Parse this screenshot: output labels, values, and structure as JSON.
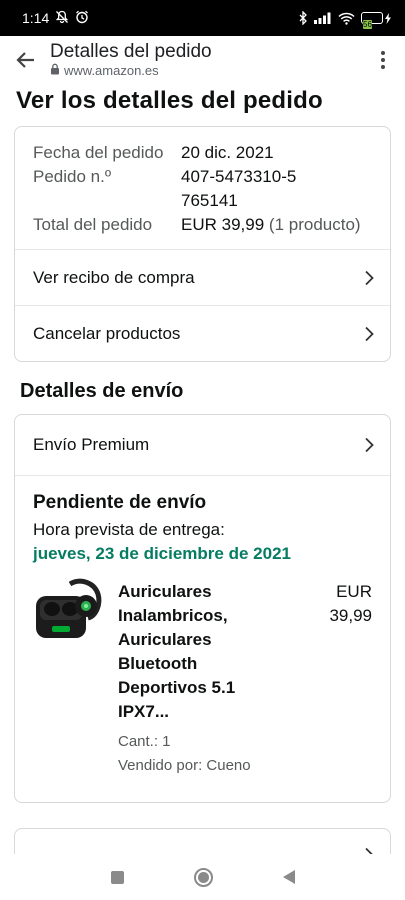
{
  "status_bar": {
    "time": "1:14",
    "battery_level": "56"
  },
  "browser": {
    "page_title": "Detalles del pedido",
    "url": "www.amazon.es"
  },
  "main_heading": "Ver los detalles del pedido",
  "order_summary": {
    "rows": [
      {
        "label": "Fecha del pedido",
        "value": "20 dic. 2021"
      },
      {
        "label": "Pedido n.º",
        "value": "407-5473310-5765141"
      },
      {
        "label": "Total del pedido",
        "value": "EUR 39,99",
        "extra": "(1 producto)"
      }
    ],
    "links": [
      {
        "label": "Ver recibo de compra"
      },
      {
        "label": "Cancelar productos"
      }
    ]
  },
  "shipping": {
    "heading": "Detalles de envío",
    "method": "Envío Premium",
    "status": "Pendiente de envío",
    "eta_label": "Hora prevista de entrega:",
    "eta_date": "jueves, 23 de diciembre de 2021",
    "eta_color": "#067d62",
    "product": {
      "title": "Auriculares Inalambricos, Auriculares Bluetooth Deportivos 5.1 IPX7...",
      "quantity": "Cant.: 1",
      "seller": "Vendido por: Cueno",
      "price": "EUR 39,99"
    }
  }
}
